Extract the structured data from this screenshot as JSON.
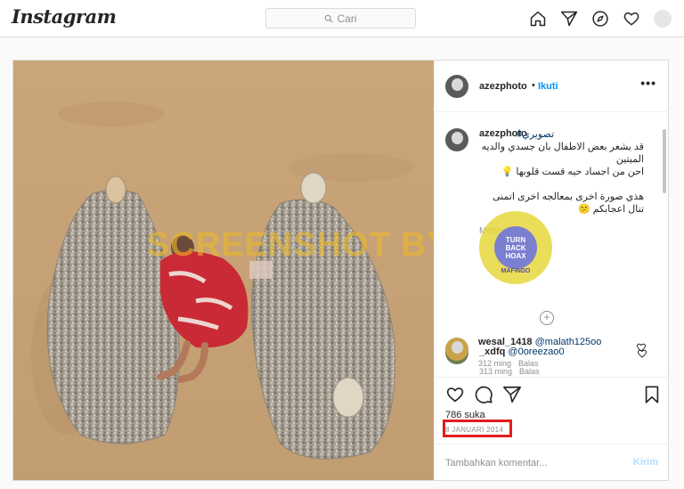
{
  "app": {
    "logo": "Instagram"
  },
  "search": {
    "placeholder": "Cari"
  },
  "nav": {
    "icons": [
      "home-icon",
      "direct-icon",
      "explore-icon",
      "heart-icon",
      "profile-avatar"
    ]
  },
  "post": {
    "username": "azezphoto",
    "dot": "•",
    "follow": "Ikuti",
    "more": "•••",
    "caption": {
      "username": "azezphoto",
      "tag": "#تصويري",
      "line1": "قد يشعر بعض الاطفال بان جسدي والديه",
      "line2": "الميتين",
      "line3": "احن من اجساد حيه قست قلوبها 💡",
      "line4": "هذي صورة اخرى بمعالجه اخرى اتمنى",
      "line5": "تنال اعجابكم 😕",
      "time": "Melting"
    },
    "watermark": {
      "text": "SCREENSHOT BY",
      "badge_top": "TURN",
      "badge_mid": "BACK",
      "badge_bottom": "HOAX",
      "badge_ring": "MAFINDO"
    },
    "comments": [
      {
        "user": "_xdfq",
        "mention": "@0oreezao0",
        "time": "313 ming",
        "reply": "Balas"
      },
      {
        "user": "wesal_1418",
        "mention": "@malath125oo",
        "time": "312 ming",
        "reply": "Balas"
      }
    ],
    "likes": "786 suka",
    "date": "8 JANUARI 2014",
    "add_comment": {
      "placeholder": "Tambahkan komentar...",
      "post": "Kirim"
    }
  }
}
